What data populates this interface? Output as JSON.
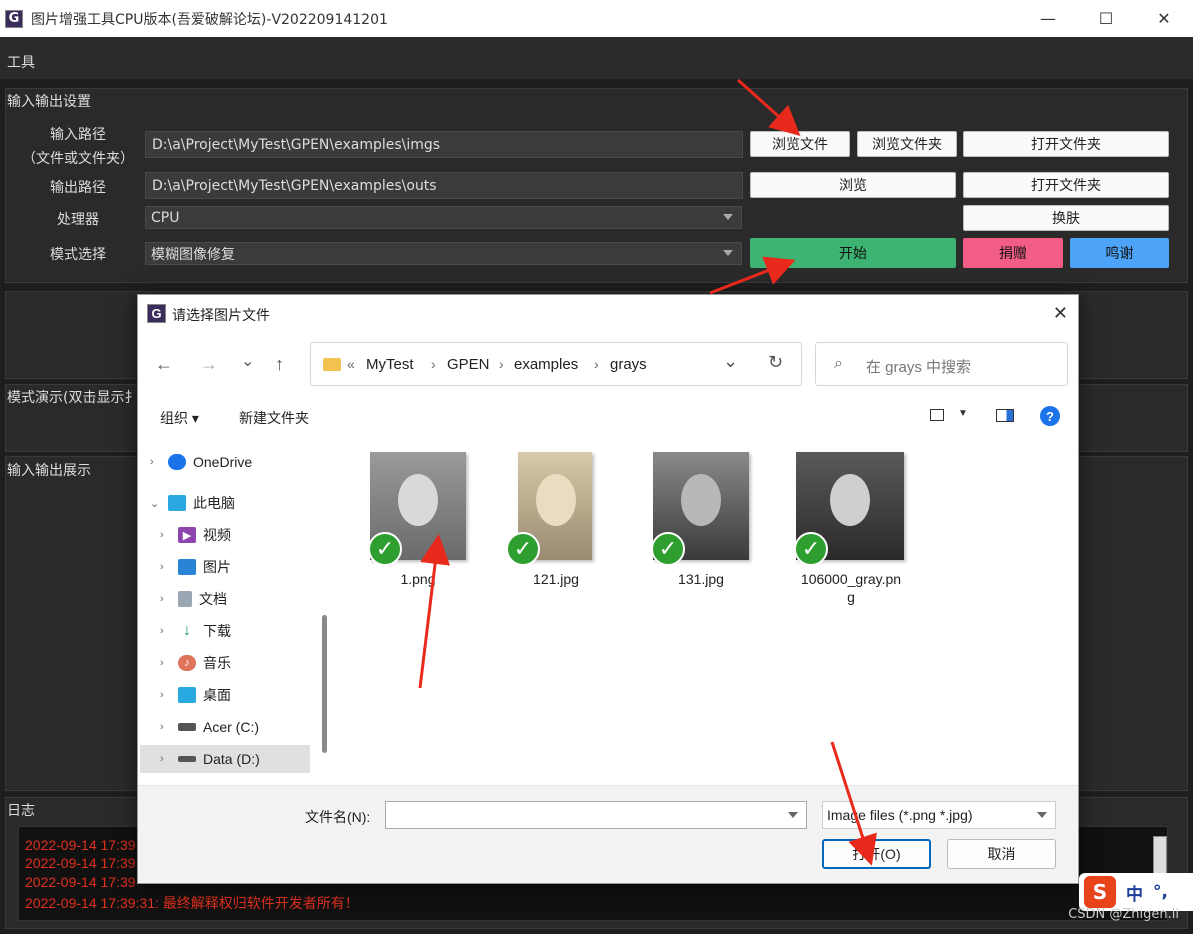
{
  "window": {
    "title": "图片增强工具CPU版本(吾爱破解论坛)-V202209141201",
    "logo": "G",
    "controls": [
      "—",
      "☐",
      "✕"
    ]
  },
  "menu": {
    "tools": "工具"
  },
  "io_settings": {
    "group_title": "输入输出设置",
    "input_label_1": "输入路径",
    "input_label_2": "（文件或文件夹）",
    "input_path": "D:\\a\\Project\\MyTest\\GPEN\\examples\\imgs",
    "browse_file": "浏览文件",
    "browse_folder": "浏览文件夹",
    "open_folder_1": "打开文件夹",
    "output_label": "输出路径",
    "output_path": "D:\\a\\Project\\MyTest\\GPEN\\examples\\outs",
    "browse": "浏览",
    "open_folder_2": "打开文件夹",
    "processor_label": "处理器",
    "processor_value": "CPU",
    "skin": "换肤",
    "mode_label": "模式选择",
    "mode_value": "模糊图像修复",
    "start": "开始",
    "donate": "捐赠",
    "thanks": "鸣谢"
  },
  "sections": {
    "demo": "模式演示(双击显示扌",
    "display": "输入输出展示",
    "log": "日志"
  },
  "log_lines": [
    "2022-09-14 17:39",
    "2022-09-14 17:39",
    "2022-09-14 17:39",
    "2022-09-14 17:39:31: 最终解释权归软件开发者所有！"
  ],
  "dialog": {
    "title": "请选择图片文件",
    "logo": "G",
    "close": "✕",
    "nav": {
      "back": "←",
      "forward": "→",
      "recent": "⌄",
      "up": "↑"
    },
    "breadcrumb_lead": "«",
    "breadcrumb": [
      "MyTest",
      "GPEN",
      "examples",
      "grays"
    ],
    "breadcrumb_sep": "›",
    "search_placeholder": "在 grays 中搜索",
    "toolbar": {
      "organize": "组织 ▾",
      "new_folder": "新建文件夹",
      "help": "?"
    },
    "sidebar": [
      {
        "label": "OneDrive",
        "icon": "cloud-icon"
      },
      {
        "label": "此电脑",
        "icon": "computer-icon"
      },
      {
        "label": "视频",
        "icon": "video-icon"
      },
      {
        "label": "图片",
        "icon": "pictures-icon"
      },
      {
        "label": "文档",
        "icon": "documents-icon"
      },
      {
        "label": "下载",
        "icon": "download-icon"
      },
      {
        "label": "音乐",
        "icon": "music-icon"
      },
      {
        "label": "桌面",
        "icon": "desktop-icon"
      },
      {
        "label": "Acer (C:)",
        "icon": "drive-icon"
      },
      {
        "label": "Data (D:)",
        "icon": "drive-icon"
      }
    ],
    "files": [
      {
        "name": "1.png"
      },
      {
        "name": "121.jpg"
      },
      {
        "name": "131.jpg"
      },
      {
        "name": "106000_gray.pn\ng"
      }
    ],
    "filename_label": "文件名(N):",
    "filter_value": "Image files (*.png *.jpg)",
    "open_button": "打开(O)",
    "cancel_button": "取消"
  },
  "watermark": "CSDN @Zhigen.li",
  "ime": {
    "logo": "S",
    "lang": "中",
    "punct": "°,"
  },
  "colors": {
    "start": "#3cb371",
    "donate": "#f25d86",
    "thanks": "#4da3f7",
    "log_text": "#e0301e"
  }
}
